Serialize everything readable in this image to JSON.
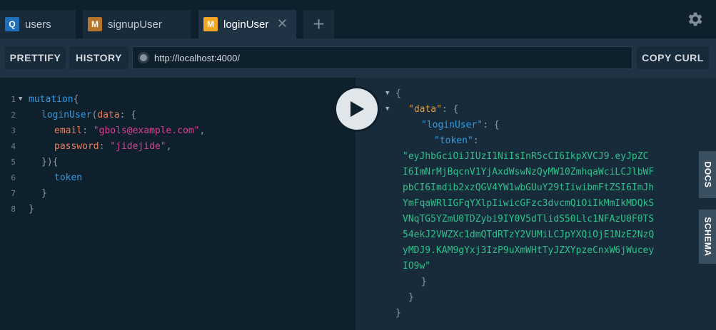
{
  "tabs": [
    {
      "badge": "Q",
      "badge_color": "#1e6fb8",
      "label": "users"
    },
    {
      "badge": "M",
      "badge_color": "#b5762b",
      "label": "signupUser"
    },
    {
      "badge": "M",
      "badge_color": "#f5a623",
      "label": "loginUser",
      "close": "✕"
    }
  ],
  "add_tab": "+",
  "toolbar": {
    "prettify": "PRETTIFY",
    "history": "HISTORY",
    "url": "http://localhost:4000/",
    "copy_curl": "COPY CURL"
  },
  "editor": {
    "line_numbers": [
      "1",
      "2",
      "3",
      "4",
      "5",
      "6",
      "7",
      "8"
    ],
    "lines": {
      "l1_kw": "mutation",
      "l1_pun": "{",
      "l2_fn": "loginUser",
      "l2_open": "(",
      "l2_arg": "data",
      "l2_rest": ": {",
      "l3_key": "email",
      "l3_colon": ": ",
      "l3_val": "\"gbols@example.com\"",
      "l3_comma": ",",
      "l4_key": "password",
      "l4_colon": ": ",
      "l4_val": "\"jidejide\"",
      "l4_comma": ",",
      "l5": "}){",
      "l6": "token",
      "l7": "}",
      "l8": "}"
    }
  },
  "result": {
    "open": "{",
    "data_key": "\"data\"",
    "login_key": "\"loginUser\"",
    "token_key": "\"token\"",
    "token_lines": [
      "\"eyJhbGciOiJIUzI1NiIsInR5cCI6IkpXVCJ9.eyJpZC",
      "I6ImNrMjBqcnV1YjAxdWswNzQyMW10ZmhqaWciLCJlbWF",
      "pbCI6Imdib2xzQGV4YW1wbGUuY29tIiwibmFtZSI6ImJh",
      "YmFqaWRlIGFqYXlpIiwicGFzc3dvcmQiOiIkMmIkMDQkS",
      "VNqTG5YZmU0TDZybi9IY0V5dTlidS50Llc1NFAzU0F0TS",
      "54ekJ2VWZXc1dmQTdRTzY2VUMiLCJpYXQiOjE1NzE2NzQ",
      "yMDJ9.KAM9gYxj3IzP9uXmWHtTyJZXYpzeCnxW6jWucey",
      "IO9w\""
    ],
    "close_inner": "}",
    "close_mid": "}",
    "close_outer": "}"
  },
  "side_tabs": {
    "docs": "DOCS",
    "schema": "SCHEMA"
  },
  "icons": {
    "settings": "gear-icon",
    "run": "play-icon"
  }
}
